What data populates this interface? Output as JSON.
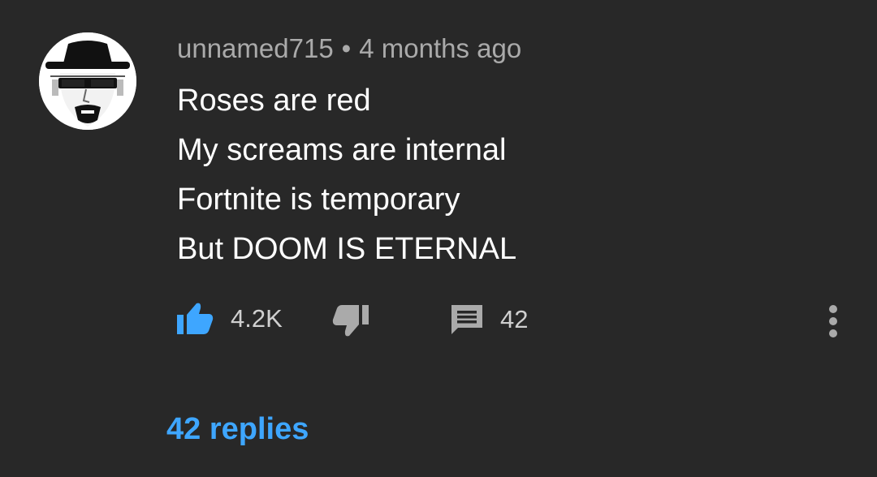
{
  "comment": {
    "author": "unnamed715",
    "separator": "•",
    "timestamp": "4 months ago",
    "lines": [
      "Roses are red",
      "My screams are internal",
      "Fortnite is temporary",
      "But DOOM IS ETERNAL"
    ],
    "like_count": "4.2K",
    "reply_count": "42",
    "replies_link": "42 replies"
  },
  "colors": {
    "background": "#282828",
    "meta_text": "#aaaaaa",
    "body_text": "#ffffff",
    "like_active": "#3ea6ff",
    "icon_gray": "#aaaaaa",
    "replies_link": "#3ea6ff"
  },
  "icons": {
    "like": "thumbs-up-icon",
    "dislike": "thumbs-down-icon",
    "reply": "comment-icon",
    "more": "more-vert-icon"
  }
}
